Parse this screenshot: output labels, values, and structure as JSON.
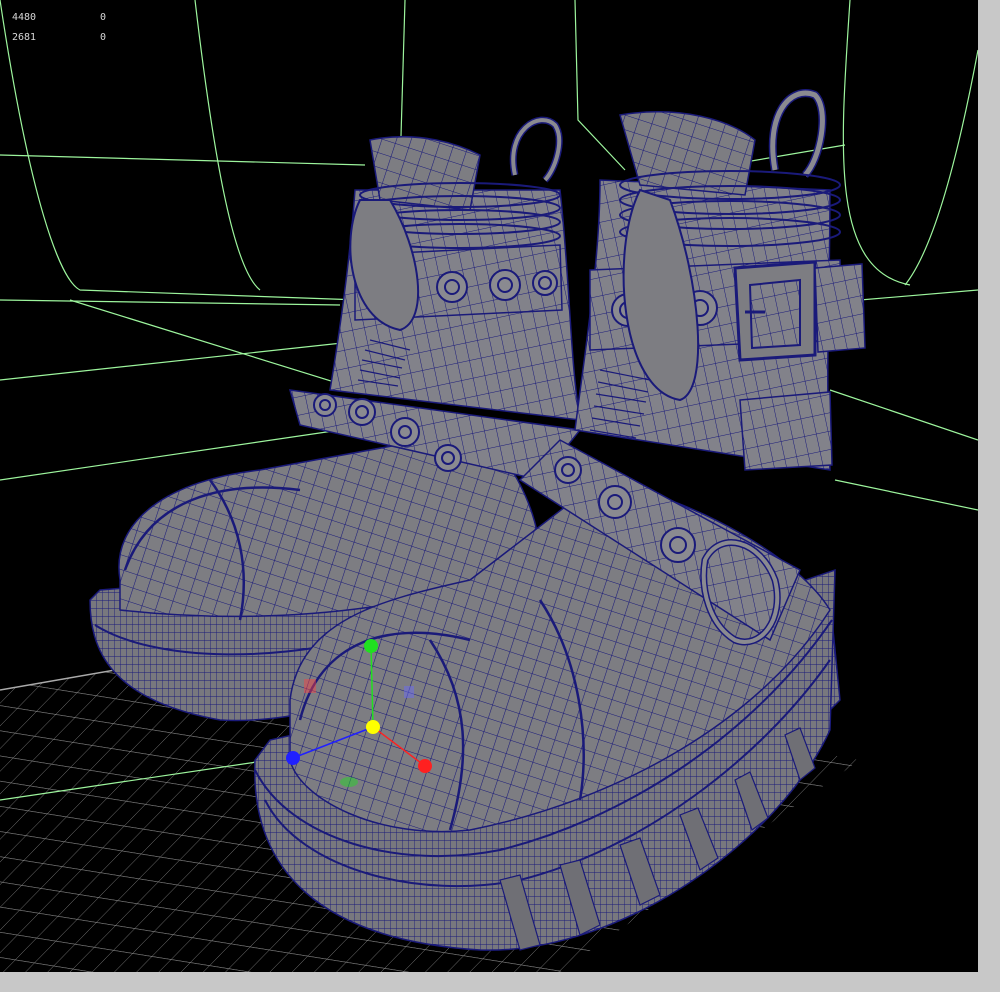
{
  "hud": {
    "rows": [
      {
        "value": "4480",
        "count": "0"
      },
      {
        "value": "2681",
        "count": "0"
      }
    ]
  },
  "colors": {
    "background": "#000000",
    "grid_guide": "#9df59d",
    "mesh_fill": "#7d7d82",
    "wireframe": "#1a1a7a",
    "floor_grid": "#9a9a9a",
    "manip_x": "#ff2020",
    "manip_y": "#20e020",
    "manip_z": "#2020ff",
    "manip_center": "#ffff00",
    "ui_frame": "#c8c8c8"
  },
  "icons": [
    "move-manipulator-icon"
  ]
}
